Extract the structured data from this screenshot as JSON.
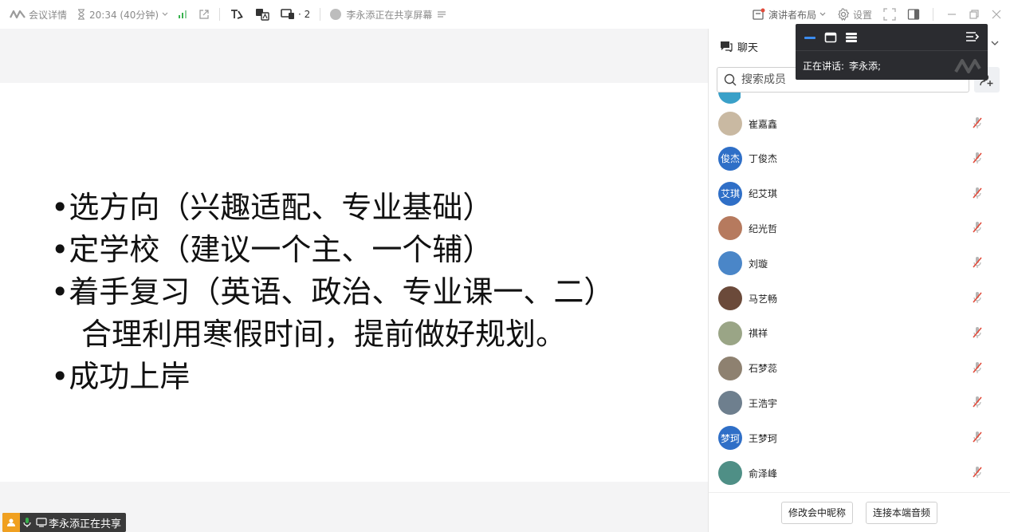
{
  "topbar": {
    "meeting_details": "会议详情",
    "time": "20:34 (40分钟)",
    "participants_count": "· 2",
    "sharing_status": "李永添正在共享屏幕",
    "layout_label": "演讲者布局",
    "settings_label": "设置"
  },
  "slide": {
    "lines": [
      "•选方向（兴趣适配、专业基础）",
      "•定学校（建议一个主、一个辅）",
      "•着手复习（英语、政治、专业课一、二）",
      "合理利用寒假时间，提前做好规划。",
      "•成功上岸"
    ]
  },
  "status_chip": {
    "text": "李永添正在共享"
  },
  "panel": {
    "title": "聊天",
    "search_placeholder": "搜索成员",
    "members": [
      {
        "name": "崔嘉鑫",
        "avatar_text": "",
        "avatar_color": "#c9b9a2"
      },
      {
        "name": "丁俊杰",
        "avatar_text": "俊杰",
        "avatar_color": "#2f6fc7"
      },
      {
        "name": "纪艾琪",
        "avatar_text": "艾琪",
        "avatar_color": "#2f6fc7"
      },
      {
        "name": "纪光哲",
        "avatar_text": "",
        "avatar_color": "#b67a5e"
      },
      {
        "name": "刘璇",
        "avatar_text": "",
        "avatar_color": "#4a86c8"
      },
      {
        "name": "马艺畅",
        "avatar_text": "",
        "avatar_color": "#6b4a3a"
      },
      {
        "name": "祺祥",
        "avatar_text": "",
        "avatar_color": "#9aa586"
      },
      {
        "name": "石梦蕊",
        "avatar_text": "",
        "avatar_color": "#8e8170"
      },
      {
        "name": "王浩宇",
        "avatar_text": "",
        "avatar_color": "#6e7f8e"
      },
      {
        "name": "王梦珂",
        "avatar_text": "梦珂",
        "avatar_color": "#2f6fc7"
      },
      {
        "name": "俞泽峰",
        "avatar_text": "",
        "avatar_color": "#4f8f86"
      }
    ],
    "rename_button": "修改会中昵称",
    "connect_audio_button": "连接本端音频"
  },
  "speaker_popup": {
    "label": "正在讲话:",
    "speaker": "李永添;"
  },
  "colors": {
    "accent": "#2f6fc7",
    "mute_red": "#e24b3b",
    "popup_bg": "#2b2c30",
    "share_orange": "#f0a020"
  }
}
